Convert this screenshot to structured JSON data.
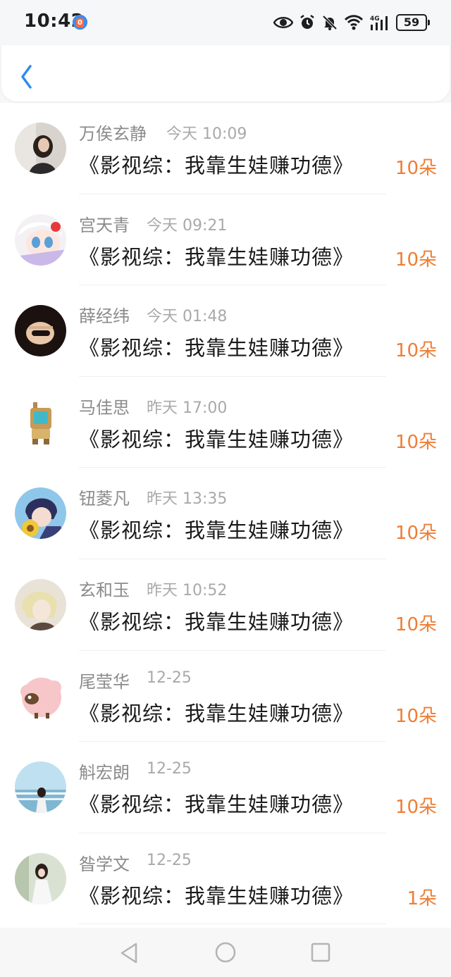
{
  "status_bar": {
    "time": "10:42",
    "app_badge": "0",
    "network": "4G",
    "battery": "59",
    "icons": [
      "eye-icon",
      "alarm-icon",
      "mute-bell-icon",
      "wifi-icon",
      "signal-icon",
      "battery-icon"
    ]
  },
  "header": {
    "back_icon": "chevron-left-icon"
  },
  "colors": {
    "accent_blue": "#2f8bf0",
    "flower_orange": "#ef7d34",
    "name_gray": "#8b8b8b"
  },
  "gifts": [
    {
      "name": "万俟玄静",
      "time": "今天 10:09",
      "title": "《影视综：我靠生娃赚功德》",
      "count": "10朵",
      "avatar": "girl-photo-avatar"
    },
    {
      "name": "宫天青",
      "time": "今天 09:21",
      "title": "《影视综：我靠生娃赚功德》",
      "count": "10朵",
      "avatar": "anime-girl-avatar"
    },
    {
      "name": "薛经纬",
      "time": "今天 01:48",
      "title": "《影视综：我靠生娃赚功德》",
      "count": "10朵",
      "avatar": "fist-photo-avatar"
    },
    {
      "name": "马佳思",
      "time": "昨天 17:00",
      "title": "《影视综：我靠生娃赚功德》",
      "count": "10朵",
      "avatar": "robot-avatar"
    },
    {
      "name": "钮菱凡",
      "time": "昨天 13:35",
      "title": "《影视综：我靠生娃赚功德》",
      "count": "10朵",
      "avatar": "anime-boy-sunflower-avatar"
    },
    {
      "name": "玄和玉",
      "time": "昨天 10:52",
      "title": "《影视综：我靠生娃赚功德》",
      "count": "10朵",
      "avatar": "anime-blonde-avatar"
    },
    {
      "name": "尾莹华",
      "time": "12-25",
      "title": "《影视综：我靠生娃赚功德》",
      "count": "10朵",
      "avatar": "pink-sheep-avatar"
    },
    {
      "name": "斛宏朗",
      "time": "12-25",
      "title": "《影视综：我靠生娃赚功德》",
      "count": "10朵",
      "avatar": "seaside-girl-avatar"
    },
    {
      "name": "昝学文",
      "time": "12-25",
      "title": "《影视综：我靠生娃赚功德》",
      "count": "1朵",
      "avatar": "white-dress-girl-avatar"
    }
  ],
  "nav_bar": {
    "icons": [
      "nav-back-icon",
      "nav-home-icon",
      "nav-recent-icon"
    ]
  }
}
